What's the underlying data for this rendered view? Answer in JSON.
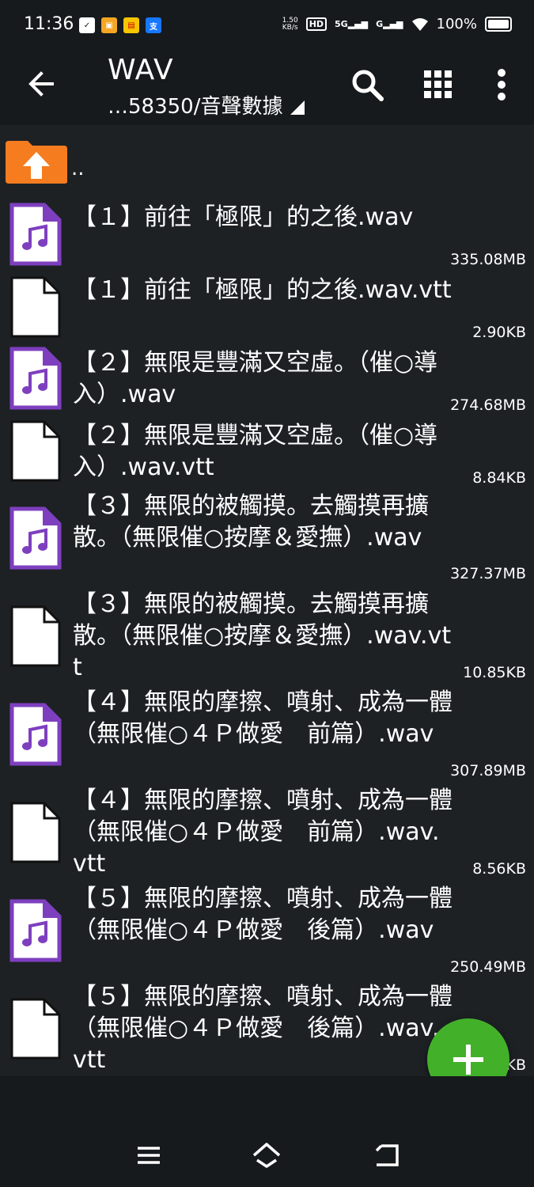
{
  "status_bar": {
    "time": "11:36",
    "net_speed_value": "1.50",
    "net_speed_unit": "KB/s",
    "hd_label": "HD",
    "signal_5g": "5G",
    "signal_g": "G",
    "battery_percent": "100%"
  },
  "toolbar": {
    "title": "WAV",
    "path": "…58350/音聲數據",
    "icons": [
      "back-arrow-icon",
      "search-icon",
      "grid-view-icon",
      "more-vert-icon"
    ]
  },
  "parent": {
    "label": ".."
  },
  "files": [
    {
      "name": "【１】前往「極限」的之後.wav",
      "size": "335.08MB",
      "type": "audio"
    },
    {
      "name": "【１】前往「極限」的之後.wav.vtt",
      "size": "2.90KB",
      "type": "text"
    },
    {
      "name": "【２】無限是豐滿又空虛。（催○導入）.wav",
      "size": "274.68MB",
      "type": "audio"
    },
    {
      "name": "【２】無限是豐滿又空虛。（催○導入）.wav.vtt",
      "size": "8.84KB",
      "type": "text"
    },
    {
      "name": "【３】無限的被觸摸。去觸摸再擴散。（無限催○按摩＆愛撫）.wav",
      "size": "327.37MB",
      "type": "audio"
    },
    {
      "name": "【３】無限的被觸摸。去觸摸再擴散。（無限催○按摩＆愛撫）.wav.vtt",
      "size": "10.85KB",
      "type": "text"
    },
    {
      "name": "【４】無限的摩擦、噴射、成為一體（無限催○４Ｐ做愛　前篇）.wav",
      "size": "307.89MB",
      "type": "audio"
    },
    {
      "name": "【４】無限的摩擦、噴射、成為一體（無限催○４Ｐ做愛　前篇）.wav.vtt",
      "size": "8.56KB",
      "type": "text"
    },
    {
      "name": "【５】無限的摩擦、噴射、成為一體（無限催○４Ｐ做愛　後篇）.wav",
      "size": "250.49MB",
      "type": "audio"
    },
    {
      "name": "【５】無限的摩擦、噴射、成為一體（無限催○４Ｐ做愛　後篇）.wav.vtt",
      "size": "KB",
      "type": "text"
    }
  ],
  "fab": {
    "icon": "plus-icon"
  },
  "nav_bar": {
    "icons": [
      "menu-lines-icon",
      "home-icon",
      "back-return-icon"
    ]
  },
  "colors": {
    "audio_icon_border": "#7e3fbf",
    "fab": "#43b02a",
    "folder": "#f57c1f"
  }
}
